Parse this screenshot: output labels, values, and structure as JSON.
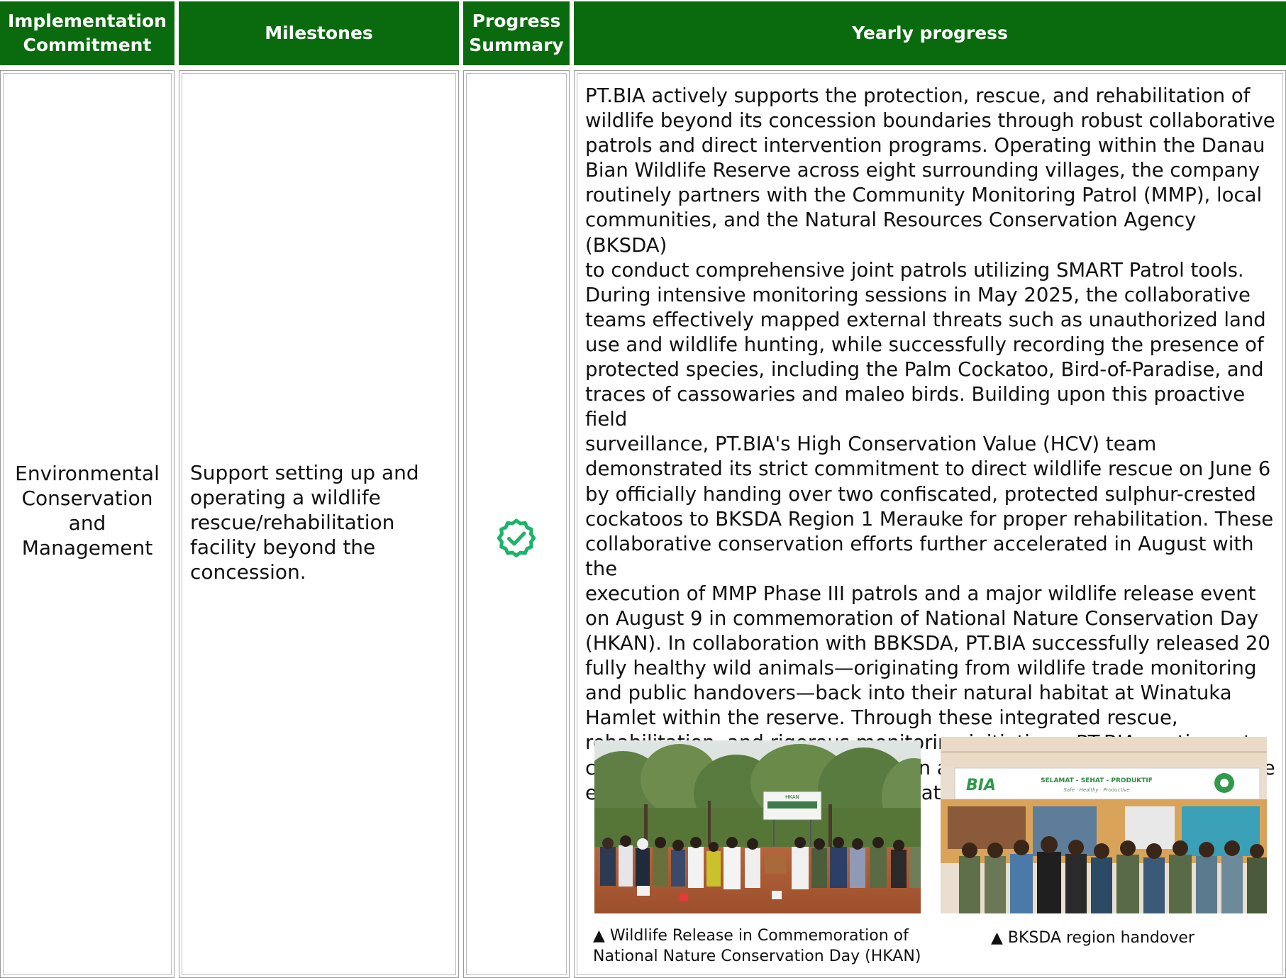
{
  "header": {
    "implementation_commitment": "Implementation\nCommitment",
    "milestones": "Milestones",
    "progress_summary": "Progress\nSummary",
    "yearly_progress": "Yearly progress"
  },
  "row": {
    "commitment": "Environmental\nConservation\nand\nManagement",
    "milestone": "Support setting up and\noperating a wildlife\nrescue/rehabilitation\nfacility beyond the\nconcession.",
    "status_icon": "check-badge-icon",
    "yearly_progress": "PT.BIA actively supports the protection, rescue, and rehabilitation of\nwildlife beyond its concession boundaries through robust collaborative\npatrols and direct intervention programs. Operating within the Danau\nBian Wildlife Reserve across eight surrounding villages, the company\nroutinely partners with the Community Monitoring Patrol (MMP), local\ncommunities, and the Natural Resources Conservation Agency (BKSDA)\nto conduct comprehensive joint patrols utilizing SMART Patrol tools.\nDuring intensive monitoring sessions in May 2025, the collaborative\nteams effectively mapped external threats such as unauthorized land\nuse and wildlife hunting, while successfully recording the presence of\nprotected species, including the Palm Cockatoo, Bird-of-Paradise, and\ntraces of cassowaries and maleo birds. Building upon this proactive field\nsurveillance, PT.BIA's High Conservation Value (HCV) team\ndemonstrated its strict commitment to direct wildlife rescue on June 6\nby officially handing over two confiscated, protected sulphur-crested\ncockatoos to BKSDA Region 1 Merauke for proper rehabilitation. These\ncollaborative conservation efforts further accelerated in August with the\nexecution of MMP Phase III patrols and a major wildlife release event\non August 9 in commemoration of National Nature Conservation Day\n(HKAN). In collaboration with BBKSDA, PT.BIA successfully released 20\nfully healthy wild animals—originating from wildlife trade monitoring\nand public handovers—back into their natural habitat at Winatuka\nHamlet within the reserve. Through these integrated rescue,\nrehabilitation, and rigorous monitoring initiatives, PT.BIA continues to\nchampion biodiversity preservation and actively combat illegal wildlife\nexploitation far beyond its immediate operational footprint."
  },
  "photos": {
    "left": {
      "caption": "▲ Wildlife Release in Commemoration of\nNational Nature Conservation Day (HKAN)",
      "banner_text": "HKAN"
    },
    "right": {
      "caption": "▲  BKSDA region handover",
      "logo_text": "BIA",
      "banner_text": "SELAMAT - SEHAT - PRODUKTIF",
      "banner_subtext": "Safe · Healthy · Productive"
    }
  },
  "colors": {
    "header_green": "#0a6b0e",
    "check_green": "#1db36a",
    "border_gray": "#9a9a9a"
  }
}
